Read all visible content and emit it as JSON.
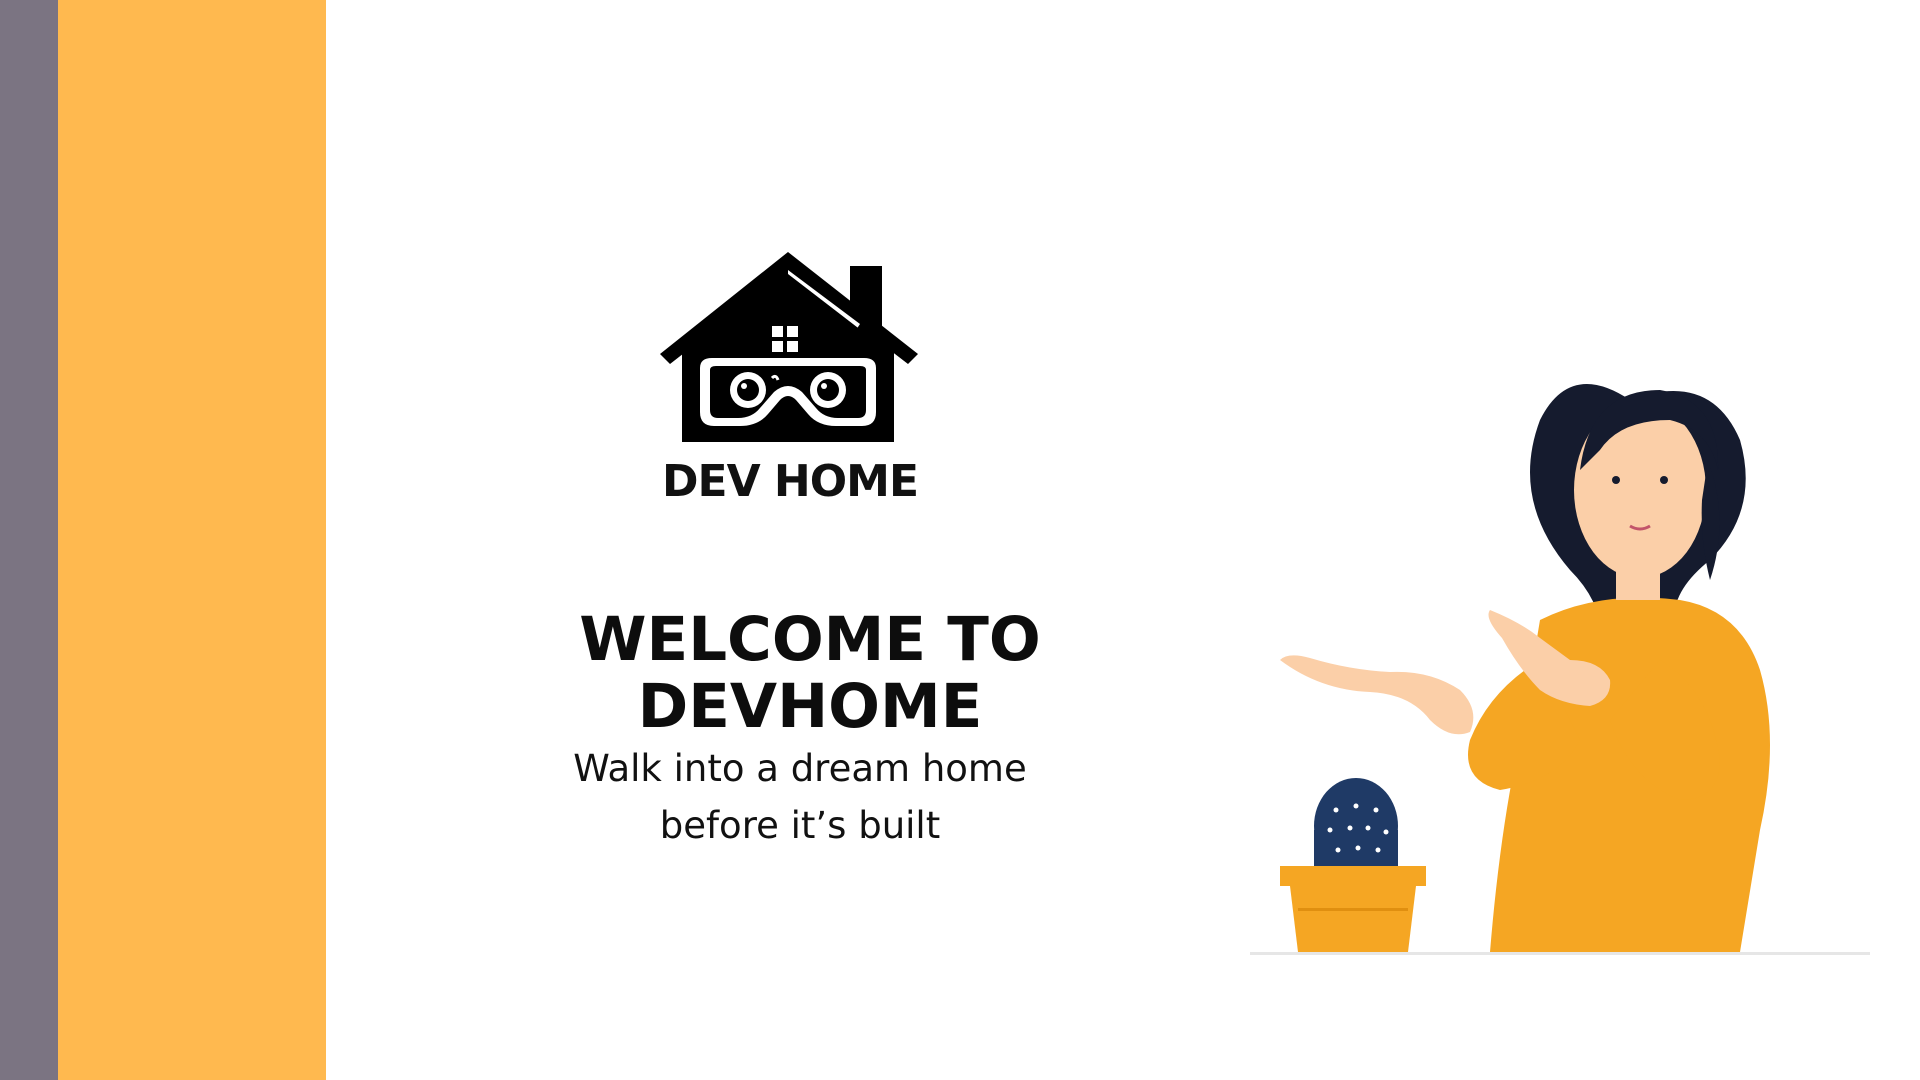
{
  "brand": {
    "logo_text": "DEV HOME",
    "logo_icon": "house-vr-headset-icon"
  },
  "hero": {
    "title": "WELCOME TO DEVHOME",
    "tagline_line1": "Walk into a dream home",
    "tagline_line2": "before it’s built"
  },
  "illustration": {
    "name": "woman-pointing-illustration",
    "plant": "cactus-pot-icon"
  },
  "colors": {
    "stripe_gray": "#7b7482",
    "stripe_orange": "#ffb94f",
    "sweater": "#f5a623",
    "hair": "#151b2e"
  }
}
